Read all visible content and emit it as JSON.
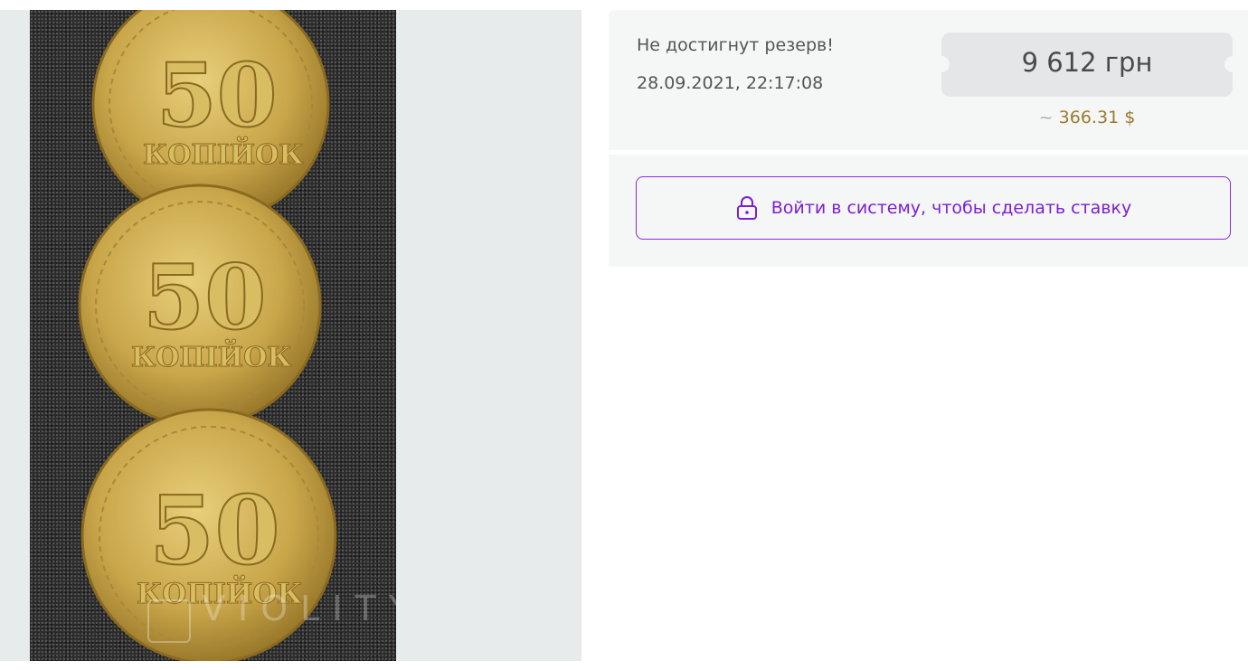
{
  "gallery": {
    "image_alt": "coins photo",
    "watermark": "VIOLITY",
    "coins": [
      {
        "number": "50",
        "word": "КОПІЙОК"
      },
      {
        "number": "50",
        "word": "КОПІЙОК"
      },
      {
        "number": "50",
        "word": "КОПІЙОК"
      }
    ]
  },
  "auction": {
    "status": "Не достигнут резерв!",
    "timestamp": "28.09.2021, 22:17:08",
    "price": "9 612 грн",
    "usd_prefix": "~",
    "usd_price": "366.31 $"
  },
  "actions": {
    "login_label": "Войти в систему, чтобы сделать ставку",
    "lock_icon": "lock-icon"
  },
  "colors": {
    "accent": "#8a2be2",
    "usd": "#9a7b2e",
    "coin": "#c9a64a"
  }
}
